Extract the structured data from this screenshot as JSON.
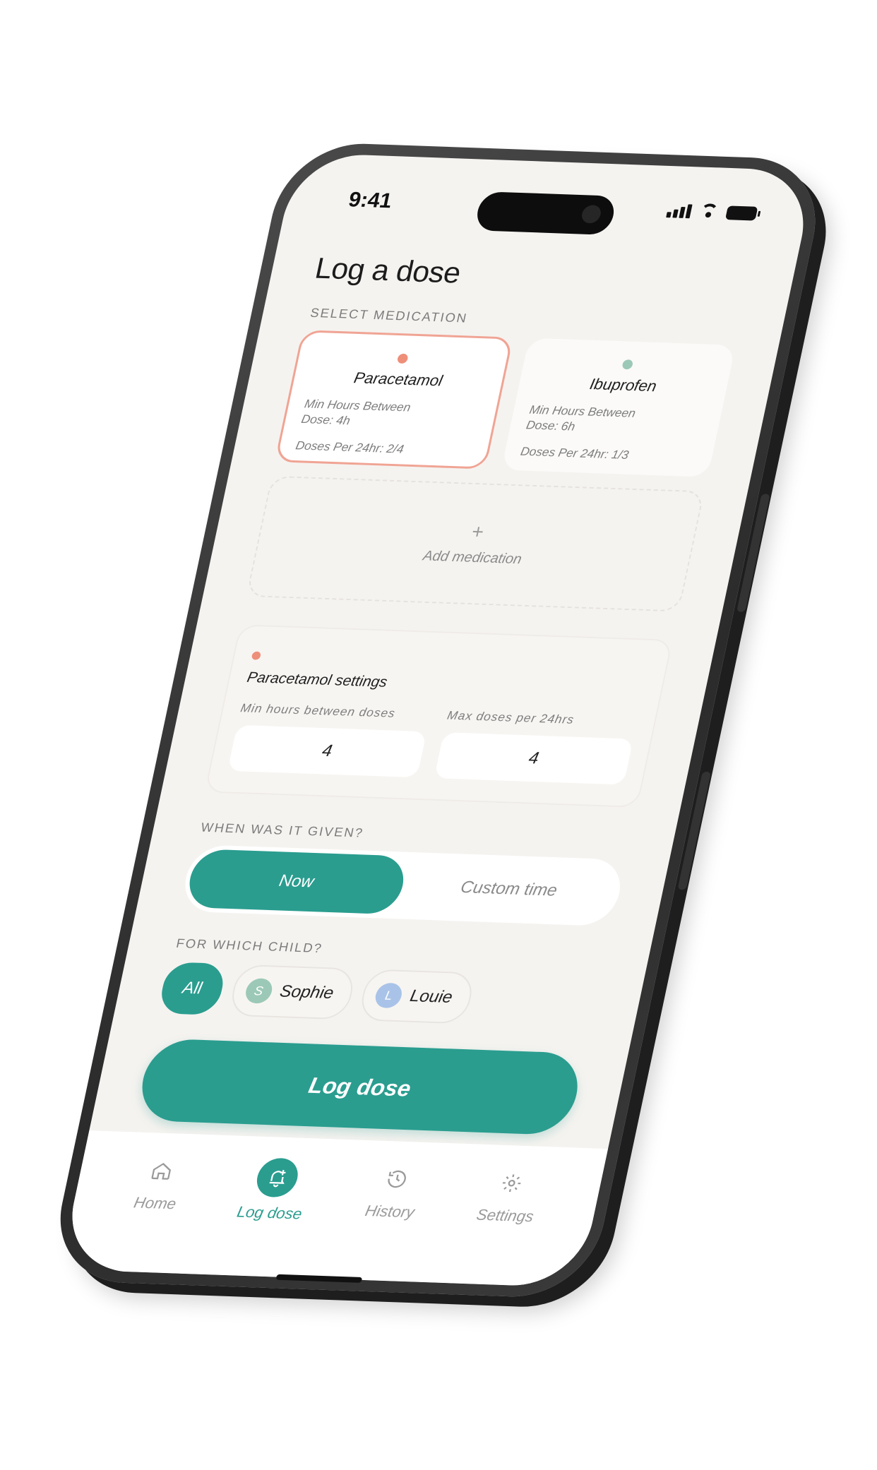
{
  "status_bar": {
    "time": "9:41"
  },
  "header": {
    "title": "Log a dose"
  },
  "select_medication": {
    "label": "SELECT MEDICATION",
    "medications": [
      {
        "name": "Paracetamol",
        "min_hours": "Min Hours Between",
        "min_hours_value": "Dose: 4h",
        "doses": "Doses Per 24hr: 2/4",
        "color": "#ee8f7a",
        "selected": true
      },
      {
        "name": "Ibuprofen",
        "min_hours": "Min Hours Between",
        "min_hours_value": "Dose: 6h",
        "doses": "Doses Per 24hr: 1/3",
        "color": "#9cc9b7",
        "selected": false
      }
    ],
    "add_label": "Add medication",
    "add_icon": "plus-icon"
  },
  "settings": {
    "title": "Paracetamol settings",
    "min_hours_label": "Min hours between doses",
    "min_hours_value": "4",
    "max_doses_label": "Max doses per 24hrs",
    "max_doses_value": "4",
    "color": "#ee8f7a"
  },
  "when": {
    "label": "WHEN WAS IT GIVEN?",
    "options": [
      "Now",
      "Custom time"
    ],
    "selected": "Now"
  },
  "child": {
    "label": "FOR WHICH CHILD?",
    "options": [
      {
        "name": "All"
      },
      {
        "name": "Sophie",
        "initial": "S",
        "color": "#9cc9b7"
      },
      {
        "name": "Louie",
        "initial": "L",
        "color": "#a9c3e8"
      }
    ],
    "selected": "All"
  },
  "log_button": {
    "label": "Log dose"
  },
  "tabbar": {
    "tabs": [
      {
        "label": "Home",
        "icon": "home-icon"
      },
      {
        "label": "Log dose",
        "icon": "bell-plus-icon",
        "active": true
      },
      {
        "label": "History",
        "icon": "history-icon"
      },
      {
        "label": "Settings",
        "icon": "gear-icon"
      }
    ]
  },
  "colors": {
    "accent": "#2a9d8f",
    "background": "#f5f3f0",
    "selected_border": "#f0a494"
  }
}
